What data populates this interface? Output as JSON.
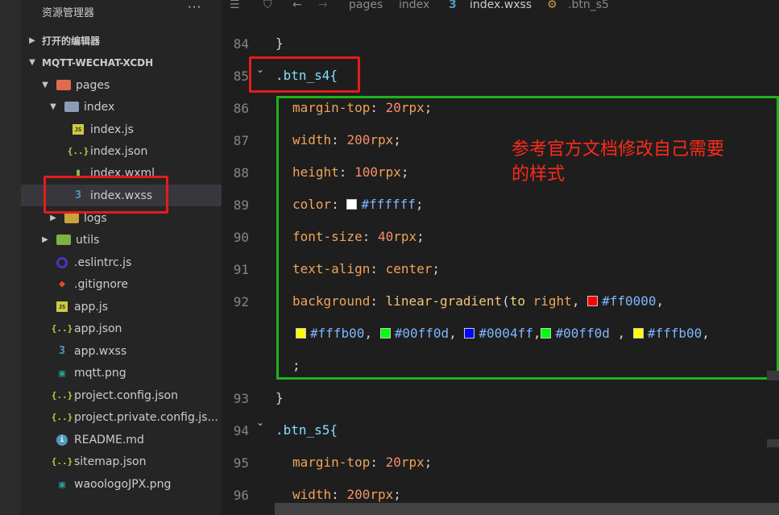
{
  "sidebar": {
    "title": "资源管理器",
    "more": "···",
    "open_editors": "打开的编辑器",
    "project": "MQTT-WECHAT-XCDH",
    "items": [
      {
        "label": "pages",
        "icon": "folder-pages-icon"
      },
      {
        "label": "index",
        "icon": "folder-open-icon"
      },
      {
        "label": "index.js",
        "icon": "js-file-icon"
      },
      {
        "label": "index.json",
        "icon": "json-file-icon"
      },
      {
        "label": "index.wxml",
        "icon": "wxml-file-icon"
      },
      {
        "label": "index.wxss",
        "icon": "css-file-icon"
      },
      {
        "label": "logs",
        "icon": "folder-icon"
      },
      {
        "label": "utils",
        "icon": "folder-utils-icon"
      },
      {
        "label": ".eslintrc.js",
        "icon": "eslint-icon"
      },
      {
        "label": ".gitignore",
        "icon": "git-icon"
      },
      {
        "label": "app.js",
        "icon": "js-file-icon"
      },
      {
        "label": "app.json",
        "icon": "json-file-icon"
      },
      {
        "label": "app.wxss",
        "icon": "css-file-icon"
      },
      {
        "label": "mqtt.png",
        "icon": "image-file-icon"
      },
      {
        "label": "project.config.json",
        "icon": "json-file-icon"
      },
      {
        "label": "project.private.config.js...",
        "icon": "json-file-icon"
      },
      {
        "label": "README.md",
        "icon": "info-icon"
      },
      {
        "label": "sitemap.json",
        "icon": "json-file-icon"
      },
      {
        "label": "waoologoJPX.png",
        "icon": "image-file-icon"
      }
    ]
  },
  "breadcrumb": {
    "pages": "pages",
    "index": "index",
    "file": "index.wxss",
    "symbol": ".btn_s5"
  },
  "lines": {
    "n84": "84",
    "n85": "85",
    "n86": "86",
    "n87": "87",
    "n88": "88",
    "n89": "89",
    "n90": "90",
    "n91": "91",
    "n92": "92",
    "n93": "93",
    "n94": "94",
    "n95": "95",
    "n96": "96"
  },
  "code": {
    "close_brace": "}",
    "sel4": ".btn_s4{",
    "sel5": ".btn_s5{",
    "margin_top": "margin-top",
    "width": "width",
    "height": "height",
    "color": "color",
    "font_size": "font-size",
    "text_align": "text-align",
    "background": "background",
    "v_20": "20",
    "v_200": "200",
    "v_100": "100",
    "v_40": "40",
    "rpx": "rpx",
    "center": "center",
    "hex_fff": "#ffffff",
    "lg": "linear-gradient",
    "to": "to",
    "right": "right",
    "c1": "#ff0000",
    "c2": "#fffb00",
    "c3": "#00ff0d",
    "c4": "#0004ff",
    "c5": "#00ff0d",
    "c6": "#fffb00",
    "semicolon": ";"
  },
  "annotation": {
    "line1": "参考官方文档修改自己需要",
    "line2": "的样式"
  },
  "colors": {
    "annotation_red": "#e51b1b",
    "annotation_green": "#1db31d",
    "swatch_white": "#ffffff",
    "swatch_red": "#ff0000",
    "swatch_yellow": "#fffb00",
    "swatch_green": "#00ff0d",
    "swatch_blue": "#0004ff"
  }
}
